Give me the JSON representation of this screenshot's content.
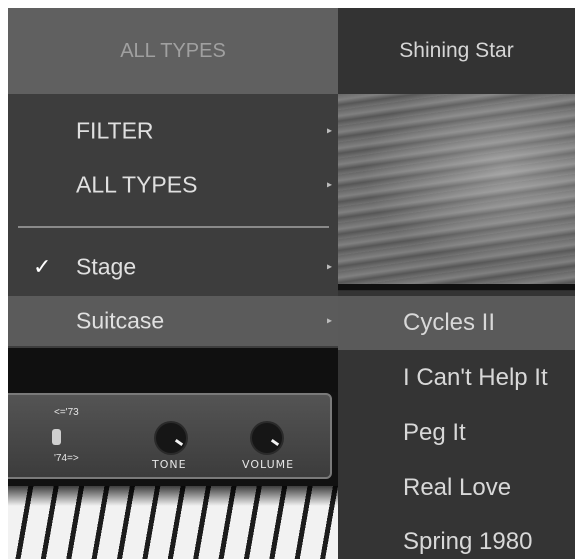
{
  "header": {
    "filter_label": "ALL TYPES",
    "preset_name": "Shining Star"
  },
  "menu": {
    "items": [
      {
        "label": "FILTER",
        "checked": false,
        "highlighted": false
      },
      {
        "label": "ALL TYPES",
        "checked": false,
        "highlighted": false
      },
      {
        "label": "Stage",
        "checked": true,
        "highlighted": false
      },
      {
        "label": "Suitcase",
        "checked": false,
        "highlighted": true
      }
    ],
    "check_mark": "✓",
    "submenu_arrow": "▸"
  },
  "submenu": {
    "items": [
      {
        "label": "Cycles II",
        "highlighted": true
      },
      {
        "label": "I Can't Help It",
        "highlighted": false
      },
      {
        "label": "Peg It",
        "highlighted": false
      },
      {
        "label": "Real Love",
        "highlighted": false
      },
      {
        "label": "Spring 1980",
        "highlighted": false
      }
    ]
  },
  "instrument": {
    "switch_top": "<='73",
    "switch_bottom": "'74=>",
    "knobs": [
      {
        "label": "TONE"
      },
      {
        "label": "VOLUME"
      }
    ]
  },
  "colors": {
    "menu_bg": "#3d3d3d",
    "highlight": "#5b5b5b",
    "header_bg": "#606060"
  }
}
